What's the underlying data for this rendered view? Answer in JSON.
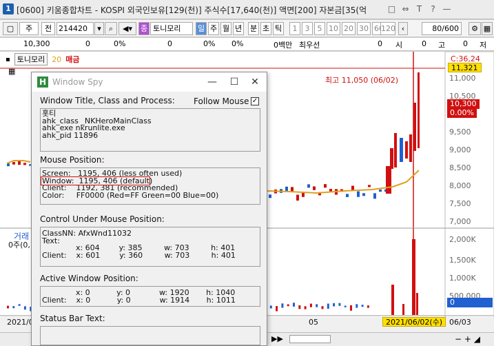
{
  "app": {
    "number": "1",
    "title": "[0600] 키움종합차트 - KOSPI 외국인보유[129(천)] 주식수[17,640(천)] 액면[200] 자본금[35(억",
    "window_icons": [
      "□",
      "⇔",
      "T",
      "?",
      "—"
    ]
  },
  "toolbar": {
    "mode_jong": "주",
    "mode_jeon": "전",
    "code": "214420",
    "search_icon": "search-icon",
    "stock_name_badge": "종",
    "stock_name": "토니모리",
    "periods": [
      "일",
      "주",
      "월",
      "년",
      "분",
      "초",
      "틱"
    ],
    "selected_period": "일",
    "intervals": [
      "1",
      "3",
      "5",
      "10",
      "20",
      "30",
      "60",
      "120"
    ],
    "count": "80/600"
  },
  "info": {
    "price": "10,300",
    "zero1": "0",
    "pct1": "0%",
    "zero2": "0",
    "pct2": "0%",
    "zero3": "0",
    "pct3": "0%",
    "pct4": "0%",
    "volume_label": "0백만",
    "best_bid": "최우선",
    "zero4": "0",
    "zero5": "0",
    "si": "시",
    "zero6": "0",
    "go": "고",
    "zero7": "0",
    "jeo": "저"
  },
  "chart_header": {
    "name": "토니모리",
    "ma_value": "20",
    "ma_label": "매금",
    "max_marker": "C:36,24",
    "max_price_annot": "최고 11,050 (06/02)"
  },
  "chart_data": {
    "type": "bar",
    "price_axis": [
      "11,000",
      "10,500",
      "10,000",
      "9,500",
      "9,000",
      "8,500",
      "8,000",
      "7,500",
      "7,000"
    ],
    "volume_axis": [
      "2,000K",
      "1,500K",
      "1,000K",
      "500,000",
      "0"
    ],
    "current_price_tag": "10,300",
    "current_pct_tag": "0.00%",
    "top_tag": "11,321",
    "zero_vol_tag": "0",
    "dates": [
      "2021/0",
      "05",
      "2021/06/02(수)",
      "06/03"
    ],
    "volume_section_label": "거래",
    "volume_sub_label": "0주(0,"
  },
  "spy": {
    "title": "Window Spy",
    "sec_title": "Window Title, Class and Process:",
    "follow_mouse": "Follow Mouse",
    "follow_checked": "✓",
    "title_lines": "홋티\nahk_class _NKHeroMainClass\nahk_exe nkrunlite.exe\nahk_pid 11896",
    "sec_mouse": "Mouse Position:",
    "mouse_lines": "Screen:   1195, 406 (less often used)\nWindow:  1195, 406 (default)\nClient:    1192, 381 (recommended)\nColor:     FF0000 (Red=FF Green=00 Blue=00)",
    "sec_control": "Control Under Mouse Position:",
    "control_lines": "ClassNN: AfxWnd11032\nText:\n              x: 604        y: 385         w: 703         h: 401\nClient:    x: 601        y: 360         w: 703         h: 401",
    "sec_active": "Active Window Position:",
    "active_lines": "              x: 0           y: 0            w: 1920       h: 1040\nClient:    x: 0           y: 0            w: 1914       h: 1011",
    "sec_status": "Status Bar Text:"
  }
}
